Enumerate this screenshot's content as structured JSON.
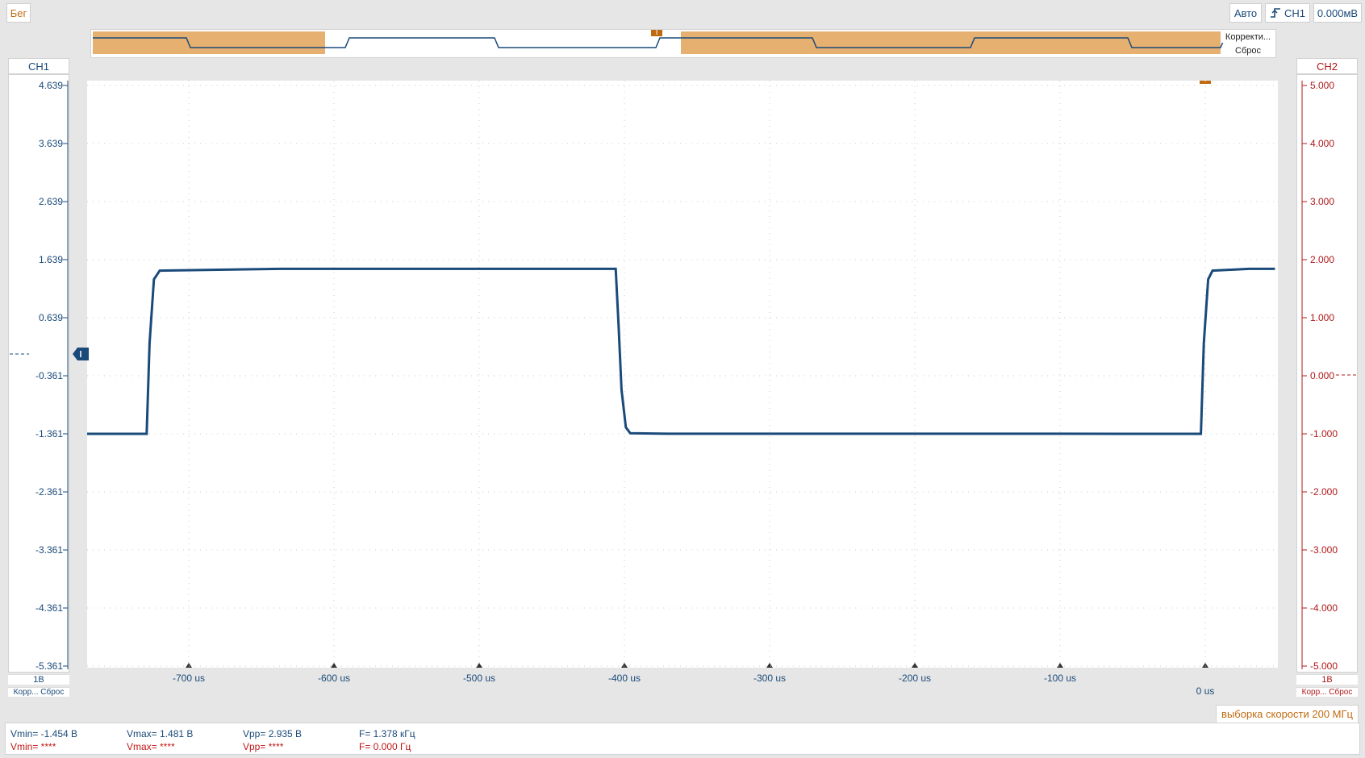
{
  "toolbar": {
    "run_label": "Бег",
    "trigger_mode_label": "Авто",
    "trigger_source_label": "CH1",
    "trigger_level_label": "0.000мВ"
  },
  "overview": {
    "correction_label": "Корректи...",
    "reset_label": "Сброс",
    "trigger_marker": "T"
  },
  "channels": {
    "ch1": {
      "name": "CH1",
      "scale_label": "1В",
      "corr_label": "Корр...",
      "reset_label": "Сброс",
      "color": "#1a4a7a"
    },
    "ch2": {
      "name": "CH2",
      "scale_label": "1В",
      "corr_label": "Корр...",
      "reset_label": "Сброс",
      "color": "#b01818"
    }
  },
  "plot": {
    "trigger_marker": "T",
    "sample_rate_label": "выборка скорости 200 МГц"
  },
  "chart_data": {
    "type": "line",
    "x_unit": "us",
    "xlim": [
      -770,
      50
    ],
    "x_ticks": [
      -700,
      -600,
      -500,
      -400,
      -300,
      -200,
      -100,
      0
    ],
    "x_tick_labels": [
      "-700 us",
      "-600 us",
      "-500 us",
      "-400 us",
      "-300 us",
      "-200 us",
      "-100 us",
      "0 us"
    ],
    "y_left_ticks": [
      "4.639",
      "3.639",
      "2.639",
      "1.639",
      "0.639",
      "-0.361",
      "-1.361",
      "-2.361",
      "-3.361",
      "-4.361",
      "-5.361"
    ],
    "y_right_ticks": [
      "5.000",
      "4.000",
      "3.000",
      "2.000",
      "1.000",
      "0.000",
      "-1.000",
      "-2.000",
      "-3.000",
      "-4.000",
      "-5.000"
    ],
    "ylim_left": [
      -5.361,
      4.639
    ],
    "ylim_right": [
      -5,
      5
    ],
    "grid": true,
    "series": [
      {
        "x": [
          -770,
          -729,
          -727,
          -724,
          -720,
          -637,
          -406,
          -404,
          -402,
          -399,
          -396,
          -370,
          -100,
          -3,
          -1,
          2,
          5,
          30,
          48
        ],
        "y": [
          -1.361,
          -1.361,
          0.2,
          1.3,
          1.45,
          1.481,
          1.481,
          0.5,
          -0.6,
          -1.25,
          -1.35,
          -1.36,
          -1.36,
          -1.361,
          0.2,
          1.3,
          1.45,
          1.481,
          1.481
        ]
      }
    ]
  },
  "measurements": {
    "ch1": {
      "vmin": "Vmin= -1.454 В",
      "vmax": "Vmax= 1.481 В",
      "vpp": "Vpp= 2.935 В",
      "freq": "F= 1.378 кГц"
    },
    "ch2": {
      "vmin": "Vmin= ****",
      "vmax": "Vmax= ****",
      "vpp": "Vpp= ****",
      "freq": "F= 0.000 Гц"
    }
  }
}
